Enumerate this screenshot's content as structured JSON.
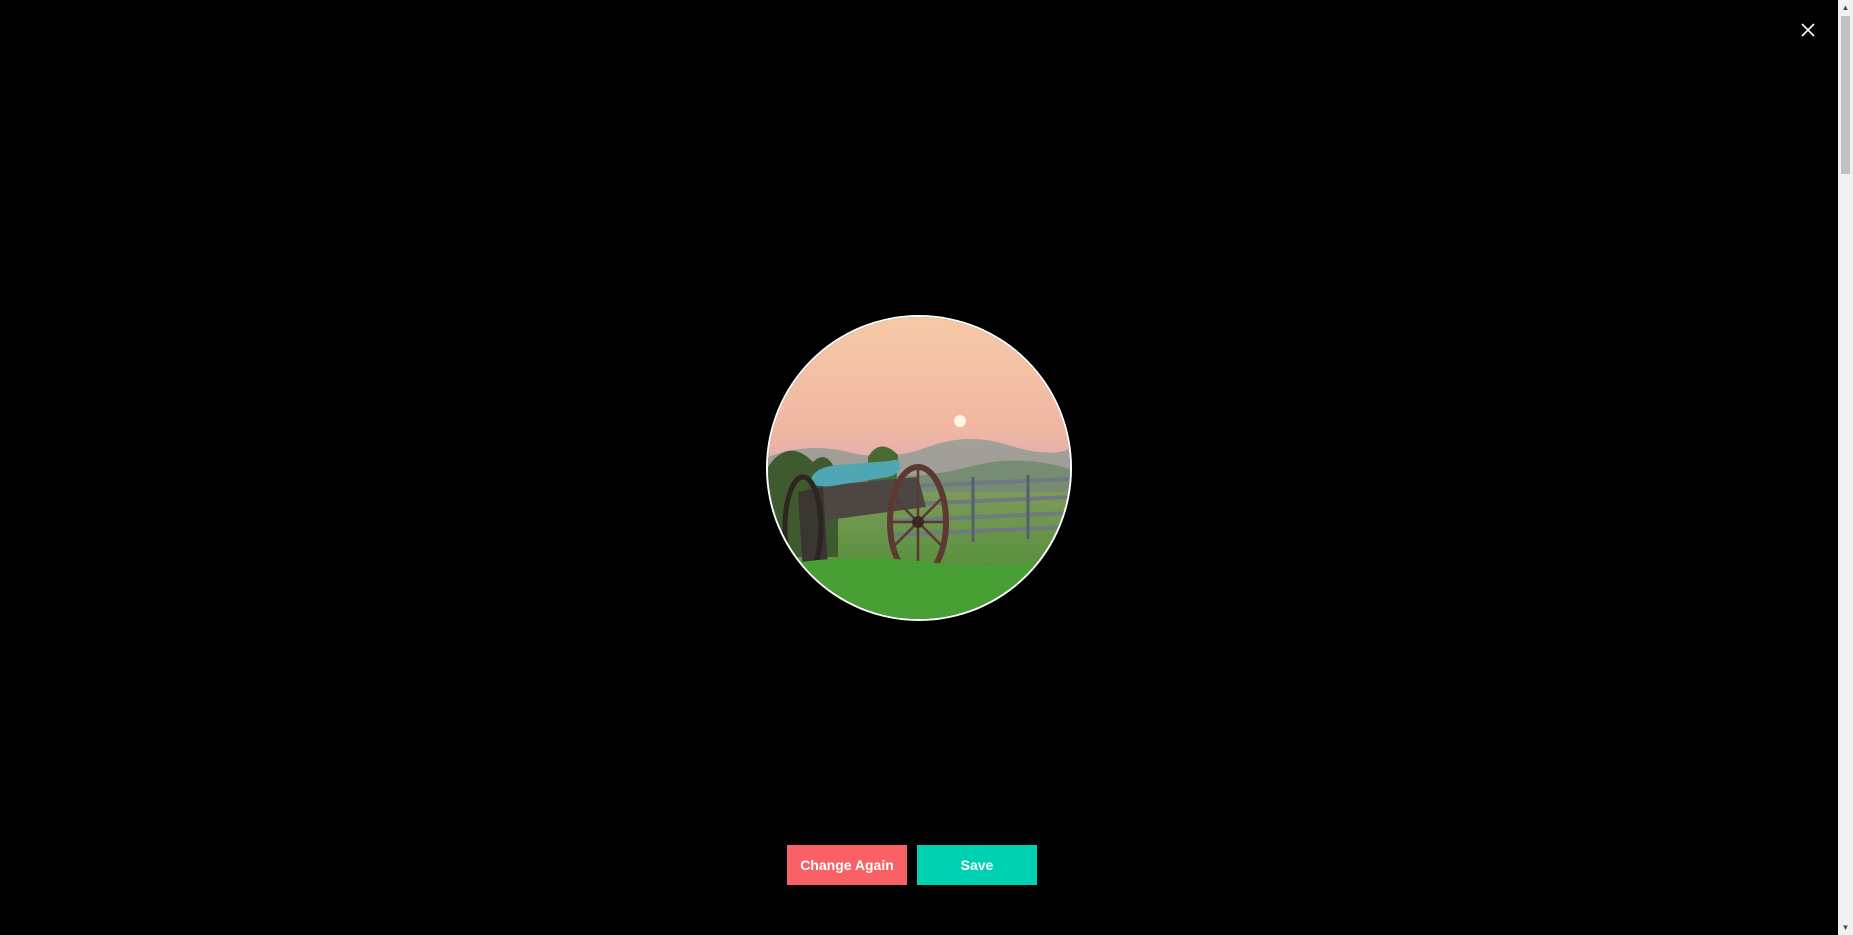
{
  "dialog": {
    "close_icon": "close-icon",
    "buttons": {
      "change_again": "Change Again",
      "save": "Save"
    }
  },
  "colors": {
    "change_again": "#f96167",
    "save": "#00d1b2",
    "background": "#000000"
  },
  "scrollbar": {
    "up_arrow": "▲",
    "down_arrow": "▼"
  }
}
